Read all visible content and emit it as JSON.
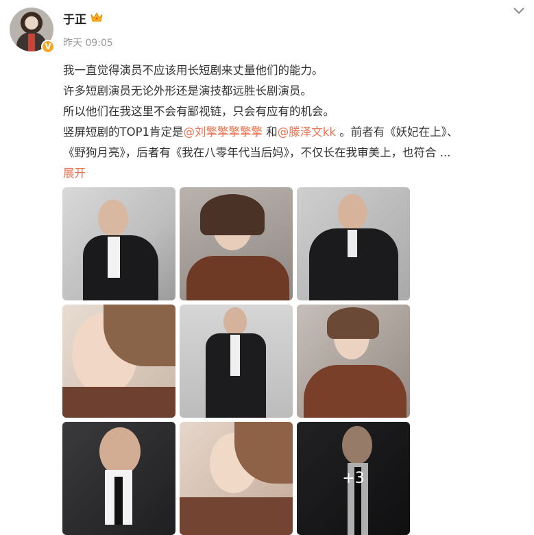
{
  "user": {
    "name": "于正",
    "time": "昨天 09:05",
    "verified_badge": "V"
  },
  "post": {
    "lines": [
      "我一直觉得演员不应该用长短剧来丈量他们的能力。",
      "许多短剧演员无论外形还是演技都远胜长剧演员。",
      "所以他们在我这里不会有鄙视链，只会有应有的机会。"
    ],
    "line4_prefix": "竖屏短剧的TOP1肯定是",
    "mention1": "@刘擎擎擎擎擎",
    "line4_mid": " 和",
    "mention2": "@滕泽文kk",
    "line4_suffix": " 。前者有《妖妃在上》、",
    "line5": "《野狗月亮》，后者有《我在八零年代当后妈》，不仅长在我审美上，也符合 ...",
    "expand": "展开"
  },
  "gallery": {
    "more_count": "+3"
  },
  "colors": {
    "accent": "#eb7350",
    "meta": "#999999",
    "text": "#333333"
  },
  "icons": {
    "crown": "crown-icon",
    "chevron": "chevron-down-icon"
  }
}
